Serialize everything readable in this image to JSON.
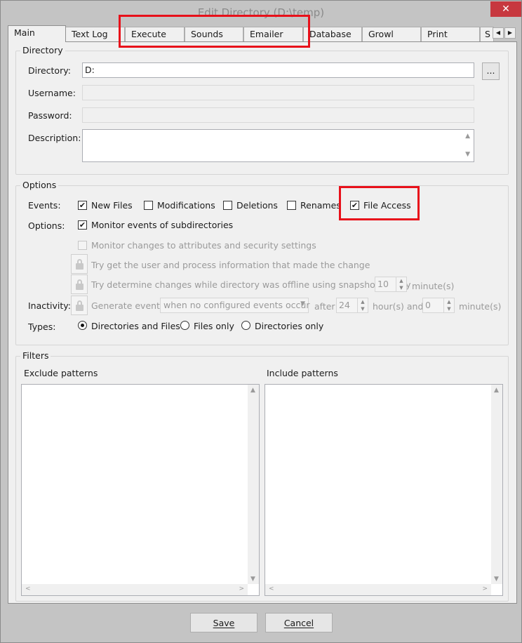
{
  "window": {
    "title": "Edit Directory (D:\\temp)",
    "close_label": "✕"
  },
  "tabs": [
    "Main",
    "Text Log",
    "Execute",
    "Sounds",
    "Emailer",
    "Database",
    "Growl",
    "Print",
    "S"
  ],
  "tab_scroll": {
    "left": "◀",
    "right": "▶"
  },
  "directory_group": {
    "title": "Directory",
    "directory_label": "Directory:",
    "directory_value": "D:",
    "browse_label": "...",
    "username_label": "Username:",
    "password_label": "Password:",
    "description_label": "Description:"
  },
  "options_group": {
    "title": "Options",
    "events_label": "Events:",
    "events": [
      {
        "label": "New Files",
        "checked": true
      },
      {
        "label": "Modifications",
        "checked": false
      },
      {
        "label": "Deletions",
        "checked": false
      },
      {
        "label": "Renames",
        "checked": false
      },
      {
        "label": "File Access",
        "checked": true
      }
    ],
    "options_label": "Options:",
    "monitor_subdirs": "Monitor events of subdirectories",
    "monitor_attributes": "Monitor changes to attributes and security settings",
    "user_process_info": "Try get the user and process information that made the change",
    "snapshots": "Try determine changes while directory was offline using snapshots every",
    "snapshots_value": "10",
    "snapshots_unit": "minute(s)",
    "inactivity_label": "Inactivity:",
    "generate_event": "Generate event",
    "generate_when": "when no configured events occur",
    "after_label": "after",
    "hours_value": "24",
    "hours_and": "hour(s) and",
    "minutes_value": "0",
    "minutes_unit": "minute(s)",
    "types_label": "Types:",
    "types": [
      {
        "label": "Directories and Files",
        "selected": true
      },
      {
        "label": "Files only",
        "selected": false
      },
      {
        "label": "Directories only",
        "selected": false
      }
    ]
  },
  "filters_group": {
    "title": "Filters",
    "exclude_label": "Exclude patterns",
    "include_label": "Include patterns"
  },
  "buttons": {
    "save": "Save",
    "cancel": "Cancel"
  },
  "icons": {
    "check": "✔",
    "up": "▲",
    "down": "▼",
    "left": "<",
    "right": ">",
    "dropdown": "▼"
  },
  "colors": {
    "highlight": "#e8101a",
    "close": "#c7383f"
  }
}
